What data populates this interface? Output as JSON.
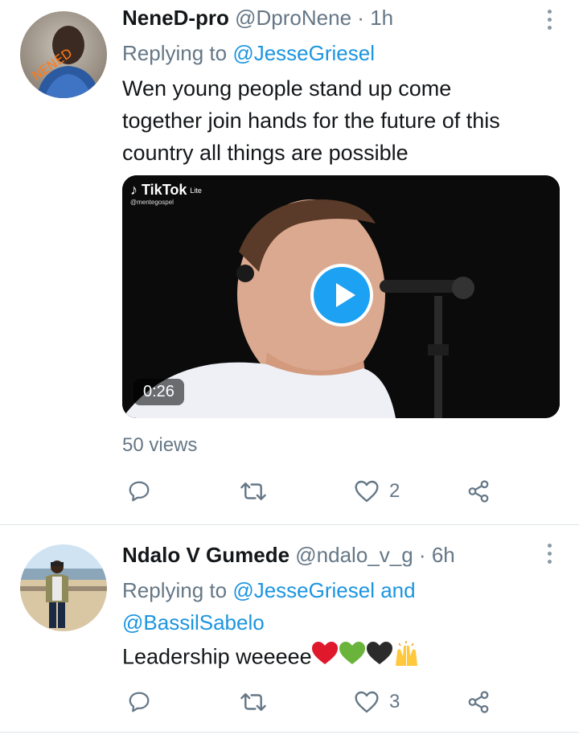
{
  "tweets": [
    {
      "name": "NeneD-pro",
      "handle": "@DproNene",
      "separator": "·",
      "time": "1h",
      "replying_prefix": "Replying to",
      "replying_to": "@JesseGriesel",
      "text_lines": [
        "Wen young people stand up come",
        "together join hands for the future of this",
        "country all things are possible"
      ],
      "media": {
        "brand": "TikTok",
        "brand_suffix": "Lite",
        "brand_user": "@mentegospel",
        "duration": "0:26"
      },
      "views": "50 views",
      "likes": "2"
    },
    {
      "name": "Ndalo V Gumede",
      "handle": "@ndalo_v_g",
      "separator": "·",
      "time": "6h",
      "replying_prefix": "Replying to",
      "replying_to": "@JesseGriesel",
      "replying_and": "and",
      "replying_to_2": "@BassilSabelo",
      "text": "Leadership weeeee",
      "likes": "3"
    }
  ],
  "icons": {
    "reply": "reply-icon",
    "retweet": "retweet-icon",
    "like": "heart-icon",
    "share": "share-icon",
    "more": "more-vertical-icon",
    "play": "play-icon"
  },
  "colors": {
    "accent": "#1da1f2",
    "mention": "#1b95e0",
    "muted": "#657786",
    "text": "#14171a"
  }
}
